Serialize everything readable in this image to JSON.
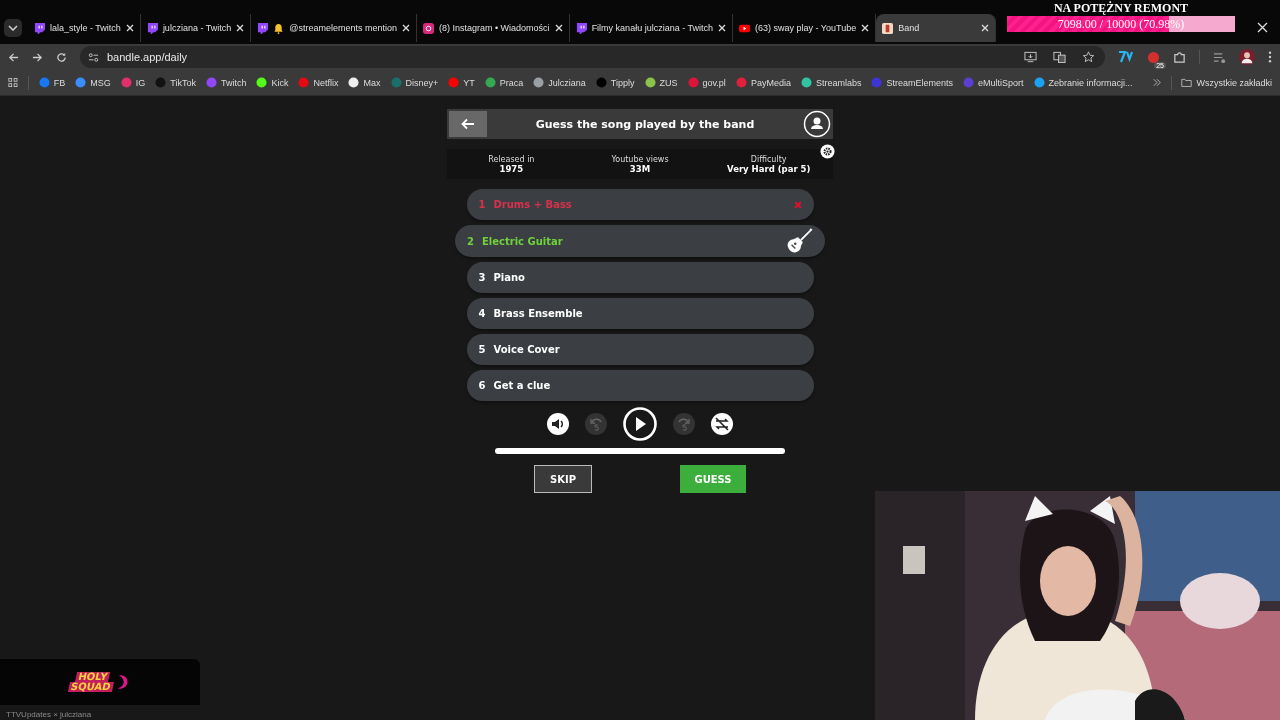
{
  "browser": {
    "tabs": [
      {
        "title": "lala_style - Twitch",
        "kind": "twitch",
        "selected": false
      },
      {
        "title": "julcziana - Twitch",
        "kind": "twitch",
        "selected": false
      },
      {
        "title": "@streamelements mention",
        "kind": "twitch-bell",
        "selected": false
      },
      {
        "title": "(8) Instagram • Wiadomości",
        "kind": "instagram",
        "selected": false
      },
      {
        "title": "Filmy kanału julcziana - Twitch",
        "kind": "twitch",
        "selected": false
      },
      {
        "title": "(63) sway play - YouTube",
        "kind": "youtube",
        "selected": false
      },
      {
        "title": "Band",
        "kind": "bandle",
        "selected": true
      }
    ],
    "url": "bandle.app/daily",
    "extension_badge": "25",
    "bookmarks": [
      {
        "label": "FB",
        "color": "#1877f2"
      },
      {
        "label": "MSG",
        "color": "#3a8dff"
      },
      {
        "label": "IG",
        "color": "#e1306c"
      },
      {
        "label": "TikTok",
        "color": "#111111"
      },
      {
        "label": "Twitch",
        "color": "#9146ff"
      },
      {
        "label": "Kick",
        "color": "#53fc18"
      },
      {
        "label": "Netflix",
        "color": "#e50914"
      },
      {
        "label": "Max",
        "color": "#eeeeee"
      },
      {
        "label": "Disney+",
        "color": "#1b6f6a"
      },
      {
        "label": "YT",
        "color": "#ff0000"
      },
      {
        "label": "Praca",
        "color": "#34a853"
      },
      {
        "label": "Julcziana",
        "color": "#9aa0a6"
      },
      {
        "label": "Tipply",
        "color": "#000000"
      },
      {
        "label": "ZUS",
        "color": "#8bc34a"
      },
      {
        "label": "gov.pl",
        "color": "#dc143c"
      },
      {
        "label": "PayMedia",
        "color": "#e0203c"
      },
      {
        "label": "Streamlabs",
        "color": "#31c3a2"
      },
      {
        "label": "StreamElements",
        "color": "#3e35d6"
      },
      {
        "label": "eMultiSport",
        "color": "#5b3fd1"
      },
      {
        "label": "Zebranie informacji...",
        "color": "#1da1f2"
      }
    ],
    "bookmarks_folder": "Wszystkie zakładki"
  },
  "game": {
    "title": "Guess the song played by the band",
    "stats": [
      {
        "label": "Released in",
        "value": "1975"
      },
      {
        "label": "Youtube views",
        "value": "33M"
      },
      {
        "label": "Difficulty",
        "value": "Very Hard (par 5)"
      }
    ],
    "clues": [
      {
        "number": "1",
        "label": "Drums + Bass",
        "kind": "wrong"
      },
      {
        "number": "2",
        "label": "Electric Guitar",
        "kind": "current"
      },
      {
        "number": "3",
        "label": "Piano",
        "kind": "pending"
      },
      {
        "number": "4",
        "label": "Brass Ensemble",
        "kind": "pending"
      },
      {
        "number": "5",
        "label": "Voice Cover",
        "kind": "pending"
      },
      {
        "number": "6",
        "label": "Get a clue",
        "kind": "pending"
      }
    ],
    "skip_button": "SKIP",
    "guess_button": "GUESS"
  },
  "overlay": {
    "goal_title": "NA POTĘŻNY REMONT",
    "goal_text": "7098.00 / 10000 (70.98%)",
    "level": 0.7098
  },
  "stream": {
    "logo_lines": [
      "HOLY",
      "SQUAD"
    ],
    "credit": "TTVUpdates × julcziana",
    "webcam": {
      "kind": "picture"
    }
  }
}
